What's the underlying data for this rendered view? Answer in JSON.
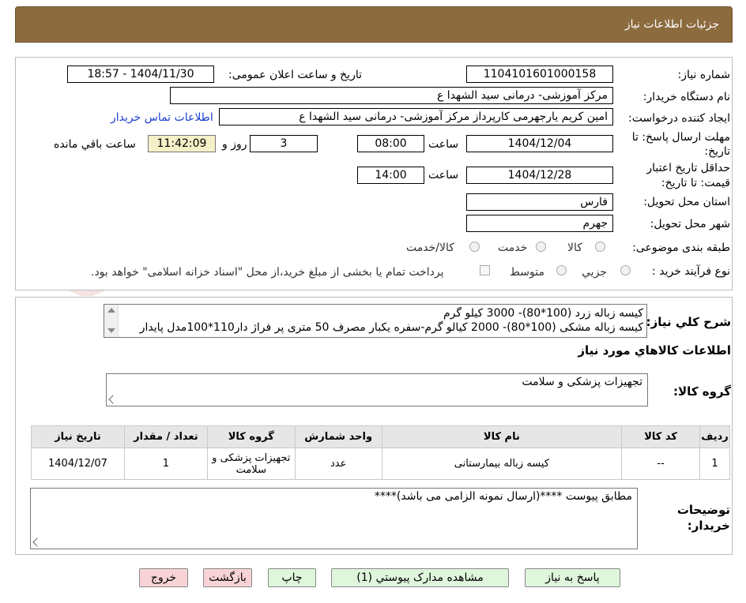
{
  "header": {
    "title": "جزئیات اطلاعات نیاز"
  },
  "form": {
    "need_number_label": "شماره نیاز:",
    "need_number": "1104101601000158",
    "announce_label": "تاریخ و ساعت اعلان عمومی:",
    "announce_value": "1404/11/30 - 18:57",
    "buyer_org_label": "نام دستگاه خریدار:",
    "buyer_org": "مرکز آموزشی- درمانی سید الشهدا ع",
    "creator_label": "ایجاد کننده درخواست:",
    "creator": "امین کریم یارجهرمی کارپرداز مرکز آموزشی- درمانی سید الشهدا ع",
    "contact_link": "اطلاعات تماس خریدار",
    "deadline_label_1": "مهلت ارسال پاسخ: تا",
    "deadline_label_2": "تاریخ:",
    "deadline_date": "1404/12/04",
    "time_label": "ساعت",
    "deadline_time": "08:00",
    "days_value": "3",
    "days_label": "روز و",
    "remaining_time": "11:42:09",
    "remaining_label": "ساعت باقي مانده",
    "validity_label_1": "حداقل تاريخ اعتبار",
    "validity_label_2": "قیمت: تا تاریخ:",
    "validity_date": "1404/12/28",
    "validity_time": "14:00",
    "province_label": "استان محل تحویل:",
    "province": "فارس",
    "city_label": "شهر محل تحویل:",
    "city": "جهرم",
    "category_label": "طبقه بندی موضوعی:",
    "category_options": [
      "کالا",
      "خدمت",
      "کالا/خدمت"
    ],
    "process_label": "نوع فرآیند خرید :",
    "process_options": [
      "جزیي",
      "متوسط"
    ],
    "payment_note": "پرداخت تمام یا بخشی از مبلغ خرید،از محل \"اسناد خزانه اسلامی\" خواهد بود."
  },
  "description": {
    "label": "شرح کلي نياز:",
    "lines": [
      "کیسه زباله زرد (100*80)- 3000 کیلو گرم",
      "کیسه زباله مشکی (100*80)- 2000 کیالو گرم-سفره یکبار مصرف 50 متری پر فراژ دار110*100مدل پایدار"
    ]
  },
  "goods": {
    "section_title": "اطلاعات کالاهاي مورد نياز",
    "group_label": "گروه کالا:",
    "group_value": "تجهیزات پزشکی و سلامت",
    "table": {
      "headers": [
        "رديف",
        "کد کالا",
        "نام کالا",
        "واحد شمارش",
        "گروه کالا",
        "تعداد / مقدار",
        "تاريخ نياز"
      ],
      "rows": [
        [
          "1",
          "--",
          "کیسه زباله بیمارستانی",
          "عدد",
          "تجهیزات پزشکی و سلامت",
          "1",
          "1404/12/07"
        ]
      ]
    }
  },
  "buyer_notes": {
    "label_1": "توضیحات",
    "label_2": "خریدار:",
    "text": "مطابق پیوست ****(ارسال نمونه الزامی می باشد)****"
  },
  "buttons": {
    "reply": "پاسخ به نياز",
    "attachments": "مشاهده مدارک پيوستي (1)",
    "print": "چاپ",
    "back": "بازگشت",
    "exit": "خروج"
  },
  "watermark": "AriaTender.neT",
  "colors": {
    "header_bg": "#8c6b3e",
    "timer_bg": "#f5f0c8",
    "green_button": "#dff5dc",
    "pink_button": "#f8d3d6",
    "link": "#1a3fd0"
  }
}
